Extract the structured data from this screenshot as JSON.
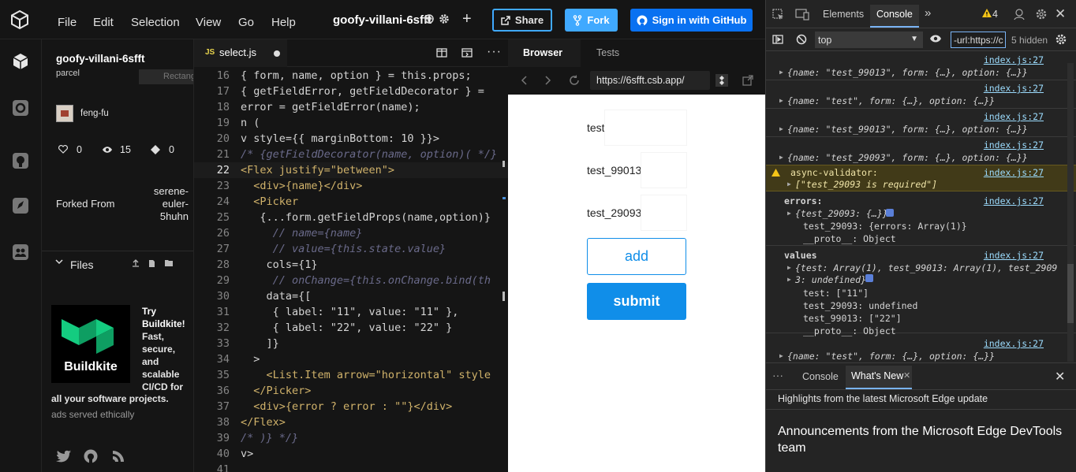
{
  "menu": {
    "file": "File",
    "edit": "Edit",
    "selection": "Selection",
    "view": "View",
    "go": "Go",
    "help": "Help"
  },
  "sandbox": {
    "name": "goofy-villani-6sfft",
    "template": "parcel",
    "author": "feng-fu",
    "likes": "0",
    "views": "15",
    "forks": "0",
    "forked_label": "Forked From",
    "forked_from_1": "serene-",
    "forked_from_2": "euler-",
    "forked_from_3": "5huhn",
    "files_label": "Files"
  },
  "buttons": {
    "share": "Share",
    "fork": "Fork",
    "signin": "Sign in with GitHub"
  },
  "ad": {
    "title": "Try Buildkite!",
    "body_1": "Fast,",
    "body_2": "secure,",
    "body_3": "and",
    "body_4": "scalable",
    "body_5": "CI/CD for",
    "body_6": "all your software projects.",
    "logo_text": "Buildkite",
    "footer": "ads served ethically"
  },
  "tooltip": "Rectangle cl...",
  "editor": {
    "tab": "select.js",
    "tab_icon": "JS",
    "lines": [
      {
        "n": "16",
        "t": "{ form, name, option } = this.props;"
      },
      {
        "n": "17",
        "t": "{ getFieldError, getFieldDecorator } ="
      },
      {
        "n": "18",
        "t": "error = getFieldError(name);"
      },
      {
        "n": "19",
        "t": "n ("
      },
      {
        "n": "20",
        "t": "v style={{ marginBottom: 10 }}>"
      },
      {
        "n": "21",
        "t": "/* {getFieldDecorator(name, option)( */}"
      },
      {
        "n": "22",
        "t": "<Flex justify=\"between\">"
      },
      {
        "n": "23",
        "t": "  <div>{name}</div>"
      },
      {
        "n": "24",
        "t": "  <Picker"
      },
      {
        "n": "25",
        "t": "   {...form.getFieldProps(name,option)}"
      },
      {
        "n": "26",
        "t": "     // name={name}"
      },
      {
        "n": "27",
        "t": "     // value={this.state.value}"
      },
      {
        "n": "28",
        "t": "    cols={1}"
      },
      {
        "n": "29",
        "t": "     // onChange={this.onChange.bind(th"
      },
      {
        "n": "30",
        "t": "    data={["
      },
      {
        "n": "31",
        "t": "     { label: \"11\", value: \"11\" },"
      },
      {
        "n": "32",
        "t": "     { label: \"22\", value: \"22\" }"
      },
      {
        "n": "33",
        "t": "    ]}"
      },
      {
        "n": "34",
        "t": "  >"
      },
      {
        "n": "35",
        "t": "    <List.Item arrow=\"horizontal\" style"
      },
      {
        "n": "36",
        "t": "  </Picker>"
      },
      {
        "n": "37",
        "t": "  <div>{error ? error : \"\"}</div>"
      },
      {
        "n": "38",
        "t": "</Flex>"
      },
      {
        "n": "39",
        "t": "/* )} */}"
      },
      {
        "n": "40",
        "t": "v>"
      },
      {
        "n": "41",
        "t": ""
      }
    ]
  },
  "preview": {
    "tab_browser": "Browser",
    "tab_tests": "Tests",
    "url": "https://6sfft.csb.app/",
    "field1": "test",
    "field2": "test_99013",
    "field3": "test_29093",
    "add": "add",
    "submit": "submit"
  },
  "devtools": {
    "tab_elements": "Elements",
    "tab_console": "Console",
    "warn_count": "4",
    "context": "top",
    "filter": "-url:https://c",
    "hidden": "5 hidden",
    "src": "index.js:27",
    "log1": "{name: \"test_99013\", form: {…}, option: {…}}",
    "log2": "{name: \"test\", form: {…}, option: {…}}",
    "log3": "{name: \"test_99013\", form: {…}, option: {…}}",
    "log4": "{name: \"test_29093\", form: {…}, option: {…}}",
    "warn_title": "async-validator:",
    "warn_body": "[\"test_29093 is required\"]",
    "errors_label": "errors:",
    "errors_obj": "{test_29093: {…}}",
    "errors_child": "test_29093: {errors: Array(1)}",
    "proto": "__proto__: Object",
    "values_label": "values",
    "values_obj_1": "{test: Array(1), test_99013: Array(1), test_2909",
    "values_obj_2": "3: undefined}",
    "val_test": "test: [\"11\"]",
    "val_29093": "test_29093: undefined",
    "val_99013": "test_99013: [\"22\"]",
    "log5": "{name: \"test\", form: {…}, option: {…}}",
    "drawer_console": "Console",
    "drawer_whatsnew": "What's New",
    "highlights": "Highlights from the latest Microsoft Edge update",
    "announce": "Announcements from the Microsoft Edge DevTools team"
  },
  "colors": {
    "accent": "#40a9ff",
    "signin_bg": "#0971f1",
    "submit_bg": "#108ee9",
    "warn_bg": "#413a18"
  }
}
